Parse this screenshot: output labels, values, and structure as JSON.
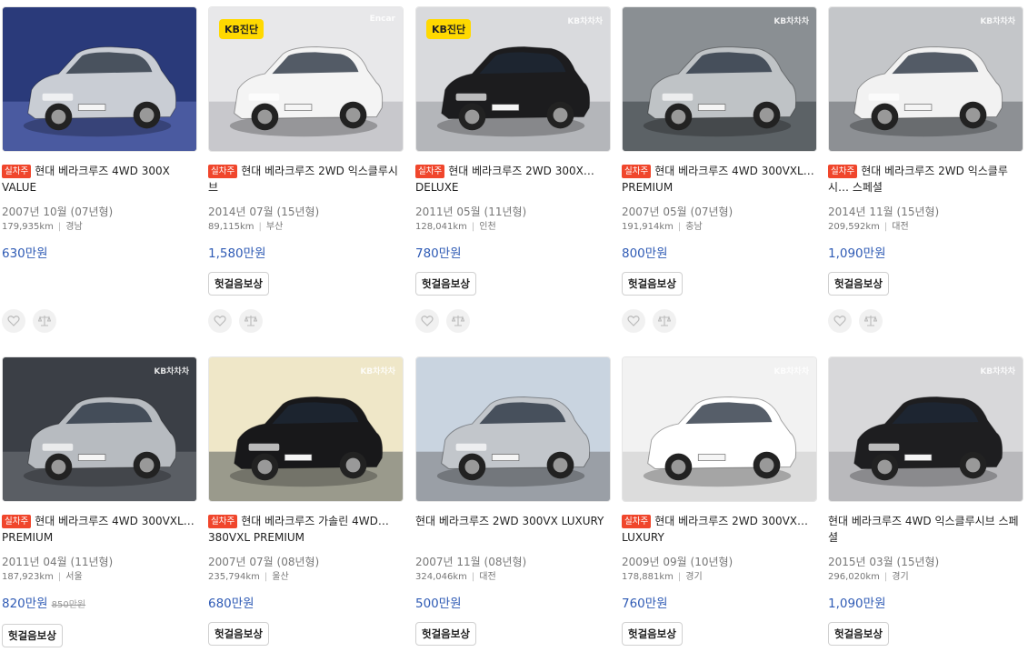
{
  "badges": {
    "live_tag": "실차주",
    "kb_label": "KB진단",
    "warranty_label": "헛걸음보상"
  },
  "colors": {
    "tag": "#f0462c",
    "price": "#2f5bb5",
    "kb_badge": "#ffd900"
  },
  "icons": {
    "favorite": "heart-icon",
    "compare": "scale-icon"
  },
  "listings": [
    {
      "title": "현대 베라크루즈 4WD 300X VALUE",
      "live": true,
      "kb": false,
      "date": "2007년 10월 (07년형)",
      "km": "179,935km",
      "region": "경남",
      "price": "630만원",
      "warranty": false,
      "watermark": "",
      "colors": {
        "bg": "#2a3a7a",
        "ground": "#4a5aa0",
        "car": "#c9cdd4"
      }
    },
    {
      "title": "현대 베라크루즈 2WD 익스클루시브",
      "live": true,
      "kb": true,
      "date": "2014년 07월 (15년형)",
      "km": "89,115km",
      "region": "부산",
      "price": "1,580만원",
      "warranty": true,
      "watermark": "Encar",
      "colors": {
        "bg": "#e8e8ea",
        "ground": "#c8c8cc",
        "car": "#f4f4f4"
      }
    },
    {
      "title": "현대 베라크루즈 2WD 300X… DELUXE",
      "live": true,
      "kb": true,
      "date": "2011년 05월 (11년형)",
      "km": "128,041km",
      "region": "인천",
      "price": "780만원",
      "warranty": true,
      "watermark": "KB차차차",
      "colors": {
        "bg": "#d9dadd",
        "ground": "#b4b6ba",
        "car": "#1c1c1e"
      }
    },
    {
      "title": "현대 베라크루즈 4WD 300VXL… PREMIUM",
      "live": true,
      "kb": false,
      "date": "2007년 05월 (07년형)",
      "km": "191,914km",
      "region": "충남",
      "price": "800만원",
      "warranty": true,
      "watermark": "KB차차차",
      "colors": {
        "bg": "#8a8f93",
        "ground": "#5c6266",
        "car": "#bfc3c6"
      }
    },
    {
      "title": "현대 베라크루즈 2WD 익스클루시… 스페셜",
      "live": true,
      "kb": false,
      "date": "2014년 11월 (15년형)",
      "km": "209,592km",
      "region": "대전",
      "price": "1,090만원",
      "warranty": true,
      "watermark": "KB차차차",
      "colors": {
        "bg": "#c4c6c9",
        "ground": "#8d9094",
        "car": "#f2f2f2"
      }
    },
    {
      "title": "현대 베라크루즈 4WD 300VXL… PREMIUM",
      "live": true,
      "kb": false,
      "date": "2011년 04월 (11년형)",
      "km": "187,923km",
      "region": "서울",
      "price": "820만원",
      "old_price": "850만원",
      "warranty": true,
      "watermark": "KB차차차",
      "colors": {
        "bg": "#3b3f46",
        "ground": "#5a5e64",
        "car": "#b7bbc0"
      }
    },
    {
      "title": "현대 베라크루즈 가솔린 4WD… 380VXL PREMIUM",
      "live": true,
      "kb": false,
      "date": "2007년 07월 (08년형)",
      "km": "235,794km",
      "region": "울산",
      "price": "680만원",
      "warranty": true,
      "watermark": "KB차차차",
      "colors": {
        "bg": "#efe7c8",
        "ground": "#9a9a8c",
        "car": "#18181a"
      }
    },
    {
      "title": "현대 베라크루즈 2WD 300VX LUXURY",
      "live": false,
      "kb": false,
      "date": "2007년 11월 (08년형)",
      "km": "324,046km",
      "region": "대전",
      "price": "500만원",
      "warranty": true,
      "watermark": "",
      "colors": {
        "bg": "#c9d4e0",
        "ground": "#9a9fa6",
        "car": "#c2c6cb"
      }
    },
    {
      "title": "현대 베라크루즈 2WD 300VX… LUXURY",
      "live": true,
      "kb": false,
      "date": "2009년 09월 (10년형)",
      "km": "178,881km",
      "region": "경기",
      "price": "760만원",
      "warranty": true,
      "watermark": "KB차차차",
      "colors": {
        "bg": "#f2f2f2",
        "ground": "#dcdcdc",
        "car": "#ffffff"
      }
    },
    {
      "title": "현대 베라크루즈 4WD 익스클루시브 스페셜",
      "live": false,
      "kb": false,
      "date": "2015년 03월 (15년형)",
      "km": "296,020km",
      "region": "경기",
      "price": "1,090만원",
      "warranty": true,
      "watermark": "KB차차차",
      "colors": {
        "bg": "#d8d8da",
        "ground": "#b9b9bc",
        "car": "#1e1e20"
      }
    }
  ]
}
